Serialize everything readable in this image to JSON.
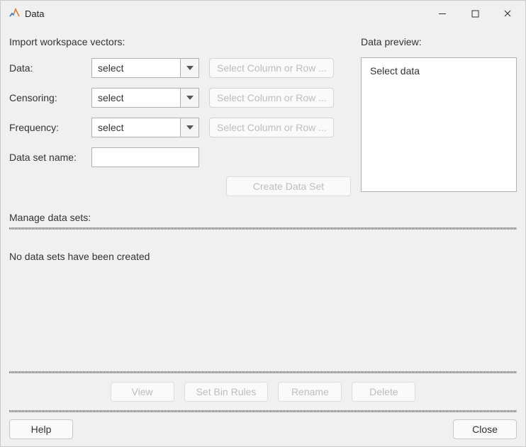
{
  "window": {
    "title": "Data"
  },
  "import": {
    "section_label": "Import workspace vectors:",
    "rows": {
      "data": {
        "label": "Data:",
        "select_value": "select",
        "col_btn": "Select Column or Row ..."
      },
      "censoring": {
        "label": "Censoring:",
        "select_value": "select",
        "col_btn": "Select Column or Row ..."
      },
      "frequency": {
        "label": "Frequency:",
        "select_value": "select",
        "col_btn": "Select Column or Row ..."
      }
    },
    "dataset_name_label": "Data set name:",
    "dataset_name_value": "",
    "create_btn": "Create Data Set"
  },
  "preview": {
    "section_label": "Data preview:",
    "content": "Select data"
  },
  "manage": {
    "label": "Manage data sets:",
    "empty_msg": "No data sets have been created"
  },
  "actions": {
    "view": "View",
    "set_bin_rules": "Set Bin Rules",
    "rename": "Rename",
    "delete": "Delete"
  },
  "footer": {
    "help": "Help",
    "close": "Close"
  }
}
